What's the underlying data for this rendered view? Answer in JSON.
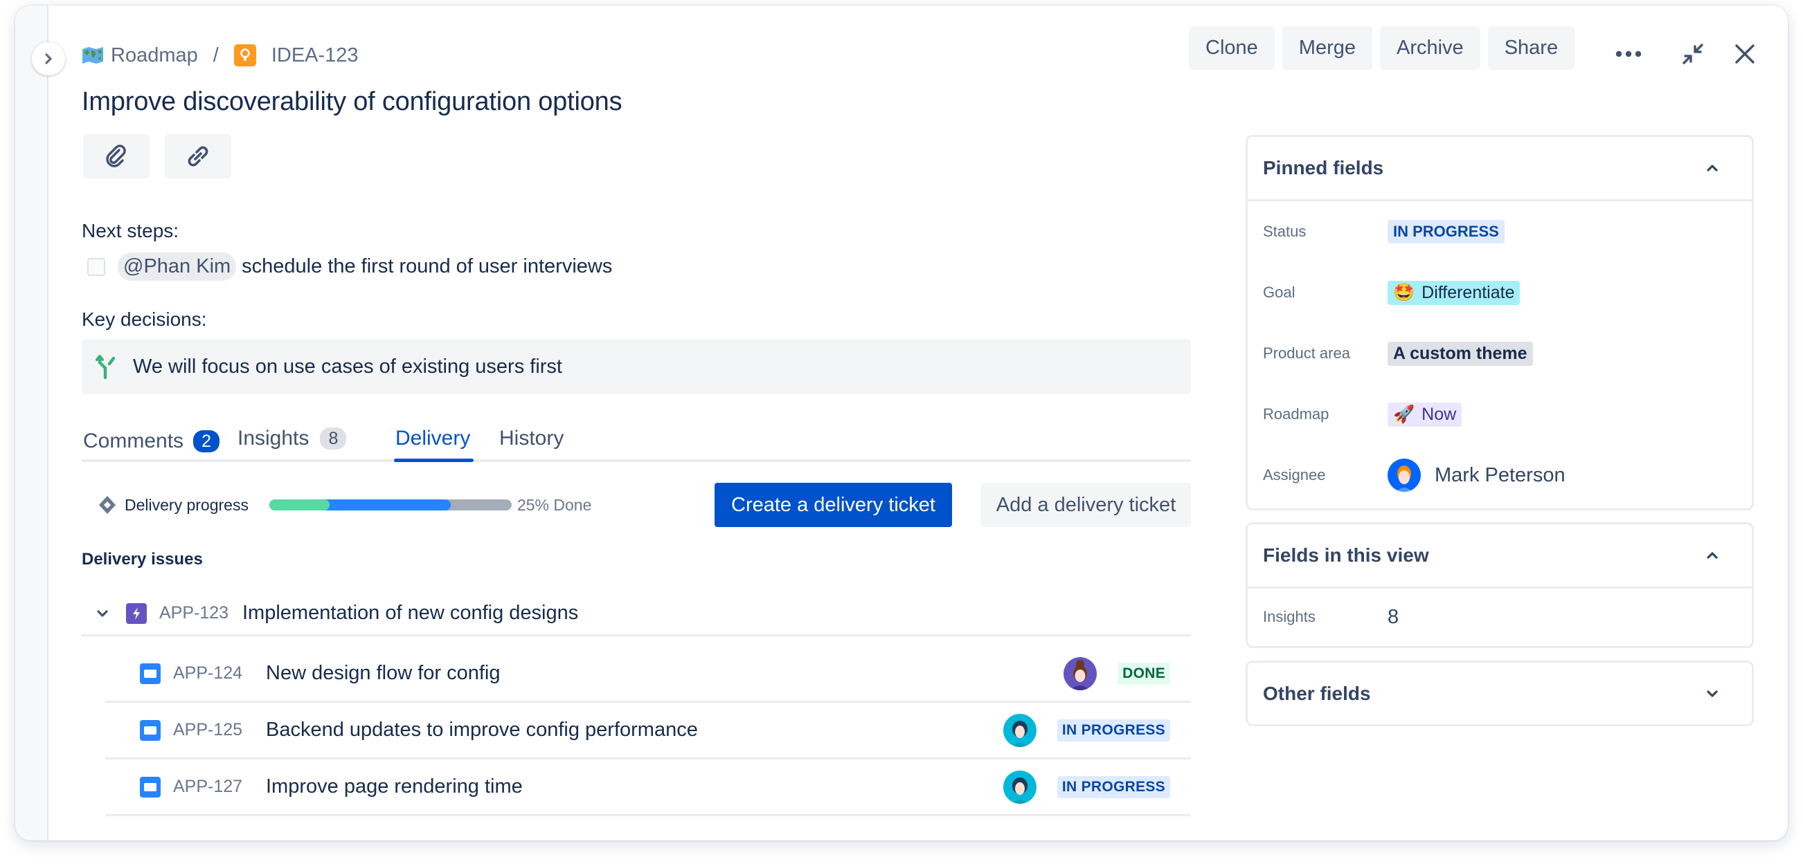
{
  "breadcrumb": {
    "parent_label": "Roadmap",
    "parent_icon": "world-map-icon",
    "issue_key": "IDEA-123",
    "issue_icon": "lightbulb-icon",
    "separator": "/"
  },
  "header_actions": {
    "clone": "Clone",
    "merge": "Merge",
    "archive": "Archive",
    "share": "Share",
    "more_icon": "more-horizontal-icon",
    "collapse_icon": "collapse-icon",
    "close_icon": "close-icon"
  },
  "title": "Improve discoverability of configuration options",
  "attach_buttons": [
    {
      "icon": "attachment-icon"
    },
    {
      "icon": "link-icon"
    }
  ],
  "next_steps": {
    "heading": "Next steps:",
    "tasks": [
      {
        "checked": false,
        "mention": "@Phan Kim",
        "text": "schedule the first round of user interviews"
      }
    ]
  },
  "key_decisions": {
    "heading": "Key decisions:",
    "items": [
      {
        "icon": "decision-icon",
        "text": "We will focus on use cases of existing users first"
      }
    ]
  },
  "tabs": [
    {
      "label": "Comments",
      "badge": "2",
      "active": false
    },
    {
      "label": "Insights",
      "badge": "8",
      "active": false
    },
    {
      "label": "Delivery",
      "badge": null,
      "active": true
    },
    {
      "label": "History",
      "badge": null,
      "active": false
    }
  ],
  "delivery": {
    "progress_label": "Delivery progress",
    "progress": {
      "done_fraction": 0.25,
      "in_progress_fraction": 0.5,
      "todo_fraction": 0.25
    },
    "progress_text": "25% Done",
    "create_button": "Create a delivery ticket",
    "add_button": "Add a delivery ticket",
    "issues_heading": "Delivery issues",
    "parent_issue": {
      "key": "APP-123",
      "summary": "Implementation of new config designs",
      "type": "epic",
      "expanded": true
    },
    "child_issues": [
      {
        "key": "APP-124",
        "summary": "New design flow for config",
        "type": "story",
        "status": "DONE",
        "assignee_avatar": "purple"
      },
      {
        "key": "APP-125",
        "summary": "Backend updates to improve config performance",
        "type": "story",
        "status": "IN PROGRESS",
        "assignee_avatar": "teal"
      },
      {
        "key": "APP-127",
        "summary": "Improve page rendering time",
        "type": "story",
        "status": "IN PROGRESS",
        "assignee_avatar": "teal"
      }
    ]
  },
  "right_panel": {
    "pinned": {
      "title": "Pinned fields",
      "expanded": true,
      "fields": [
        {
          "label": "Status",
          "value": "IN PROGRESS"
        },
        {
          "label": "Goal",
          "value": "Differentiate",
          "emoji": "🤩"
        },
        {
          "label": "Product area",
          "value": "A custom theme"
        },
        {
          "label": "Roadmap",
          "value": "Now",
          "emoji": "🚀"
        },
        {
          "label": "Assignee",
          "value": "Mark Peterson"
        }
      ]
    },
    "view_fields": {
      "title": "Fields in this view",
      "expanded": true,
      "fields": [
        {
          "label": "Insights",
          "value": "8"
        }
      ]
    },
    "other_fields": {
      "title": "Other fields",
      "expanded": false
    }
  },
  "colors": {
    "primary": "#0052cc",
    "progress_done": "#57d9a3",
    "progress_in_progress": "#2684ff",
    "progress_todo": "#a5adba",
    "idea_orange": "#ff991f",
    "epic_purple": "#6554c0",
    "story_blue": "#2684ff",
    "decision_green": "#36b37e"
  }
}
